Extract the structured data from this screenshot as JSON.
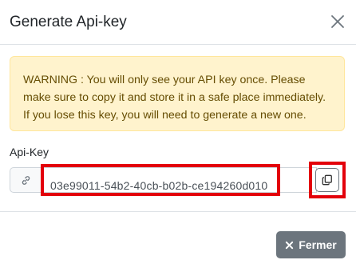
{
  "modal": {
    "title": "Generate Api-key"
  },
  "alert": {
    "text": "WARNING : You will only see your API key once. Please make sure to copy it and store it in a safe place immediately. If you lose this key, you will need to generate a new one."
  },
  "api_key": {
    "label": "Api-Key",
    "value": "03e99011-54b2-40cb-b02b-ce194260d010"
  },
  "footer": {
    "close_label": "Fermer"
  },
  "icons": {
    "close": "close-icon",
    "link": "link-icon",
    "copy": "copy-icon",
    "times": "times-icon"
  },
  "colors": {
    "alert_bg": "#fff3cd",
    "alert_text": "#664d03",
    "highlight": "#e3000b",
    "secondary_button": "#6c757d"
  }
}
